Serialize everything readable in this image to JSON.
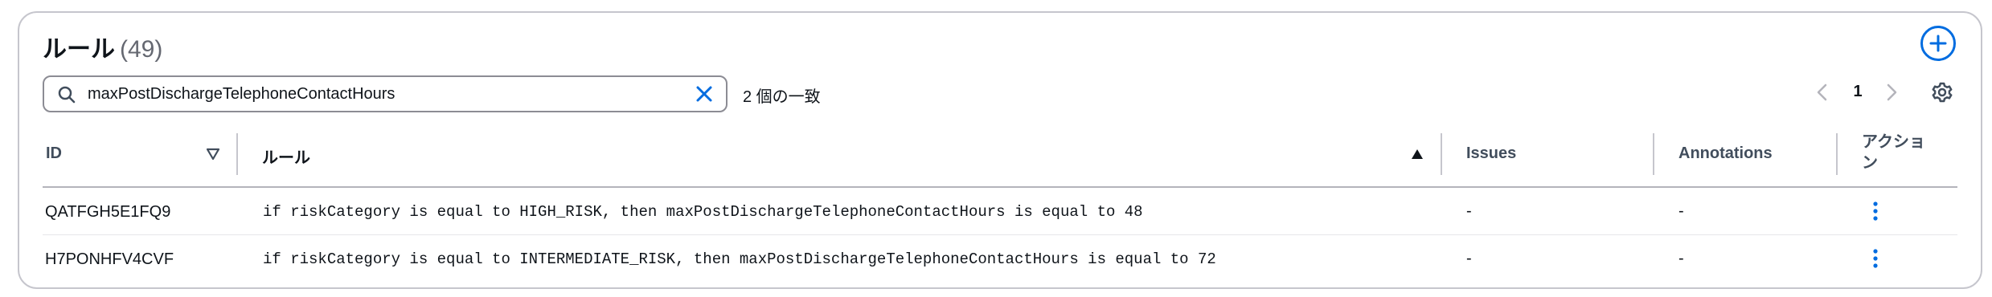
{
  "header": {
    "title": "ルール",
    "count": "(49)"
  },
  "search": {
    "value": "maxPostDischargeTelephoneContactHours",
    "placeholder": "",
    "match_text": "2 個の一致"
  },
  "pagination": {
    "current_page": "1"
  },
  "table": {
    "columns": {
      "id": "ID",
      "rule": "ルール",
      "issues": "Issues",
      "annotations": "Annotations",
      "action_line1": "アクショ",
      "action_line2": "ン"
    },
    "rows": [
      {
        "id": "QATFGH5E1FQ9",
        "rule": "if riskCategory is equal to HIGH_RISK, then maxPostDischargeTelephoneContactHours is equal to 48",
        "issues": "-",
        "annotations": "-"
      },
      {
        "id": "H7PONHFV4CVF",
        "rule": "if riskCategory is equal to INTERMEDIATE_RISK, then maxPostDischargeTelephoneContactHours is equal to 72",
        "issues": "-",
        "annotations": "-"
      }
    ]
  },
  "colors": {
    "accent": "#006ce0",
    "border": "#c6c6cd",
    "text": "#0f141a",
    "muted": "#656871"
  },
  "icons": [
    "add-icon",
    "search-icon",
    "clear-icon",
    "chevron-left-icon",
    "chevron-right-icon",
    "settings-icon",
    "sort-descending-icon",
    "sort-ascending-icon",
    "more-actions-icon"
  ]
}
